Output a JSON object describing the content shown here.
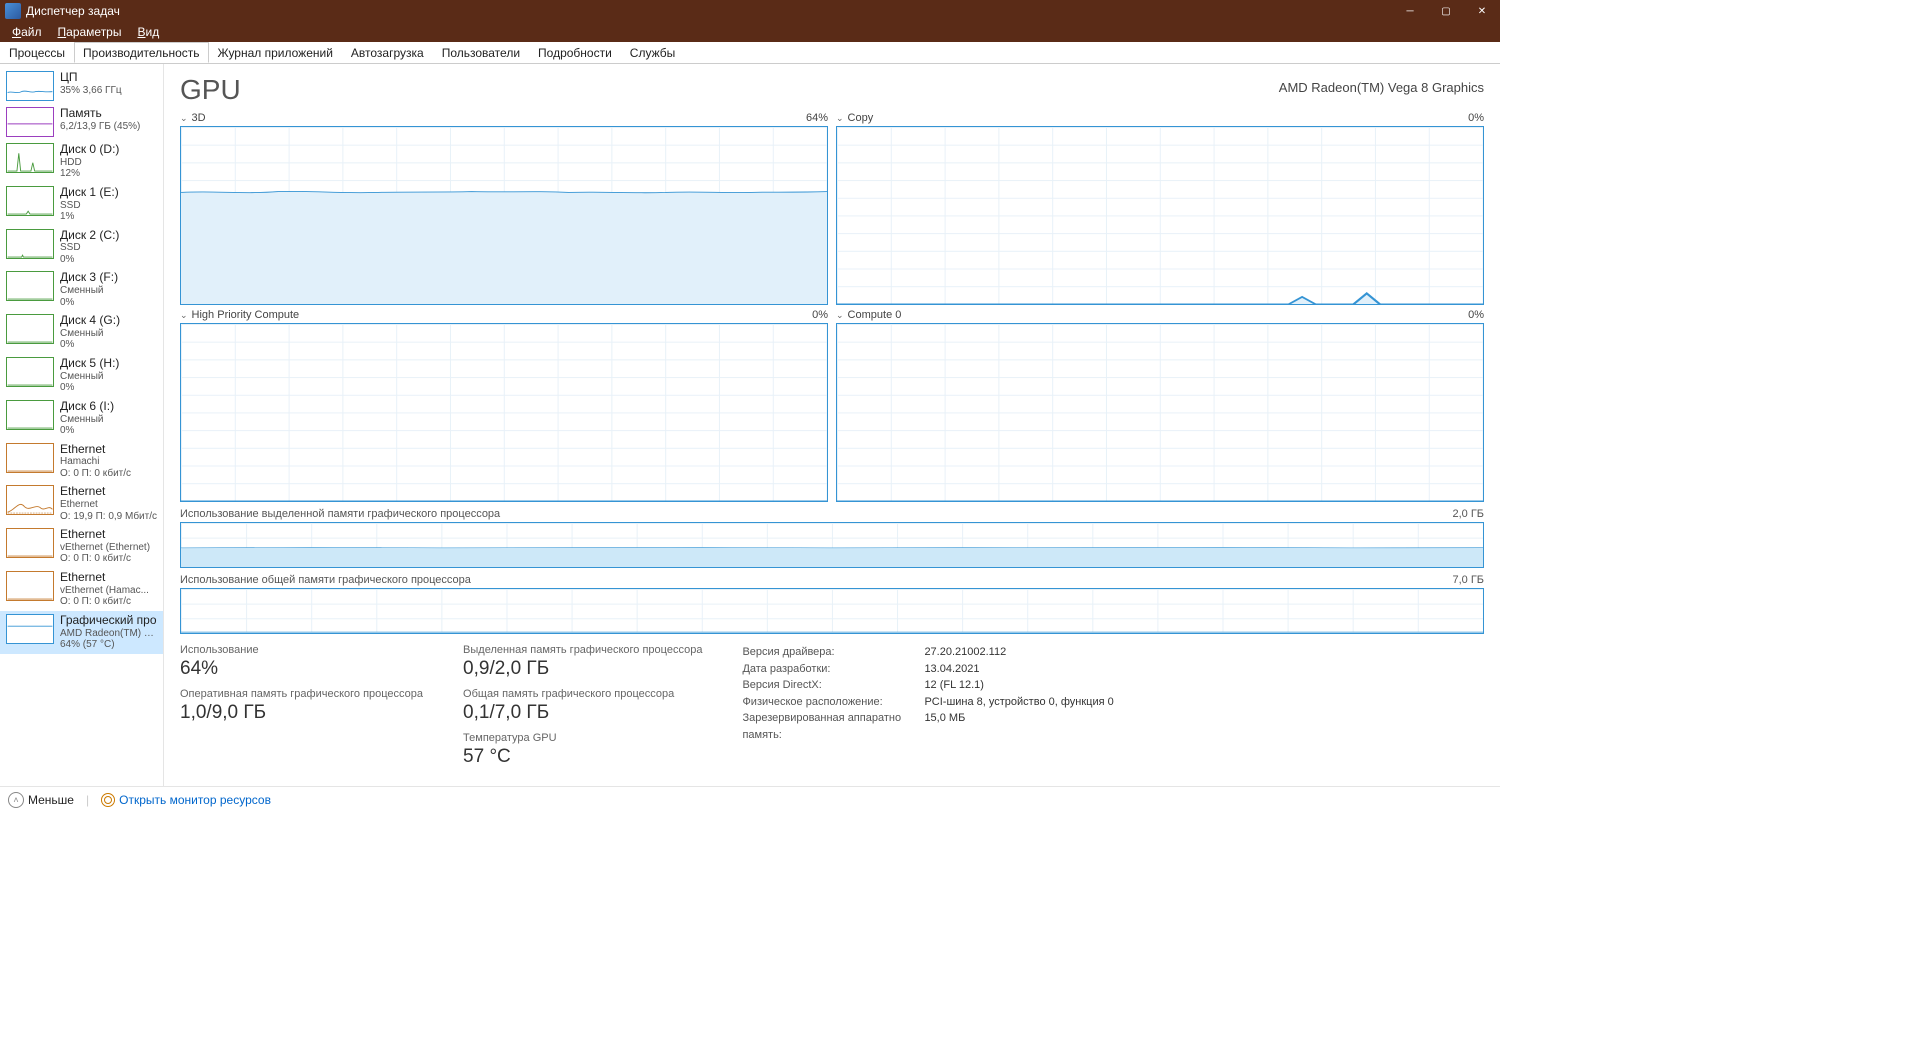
{
  "window": {
    "title": "Диспетчер задач"
  },
  "menu": {
    "file": "Файл",
    "options": "Параметры",
    "view": "Вид"
  },
  "tabs": [
    "Процессы",
    "Производительность",
    "Журнал приложений",
    "Автозагрузка",
    "Пользователи",
    "Подробности",
    "Службы"
  ],
  "activeTab": 1,
  "sidebar": [
    {
      "title": "ЦП",
      "sub1": "35% 3,66 ГГц",
      "color": "#3594d4",
      "chart": "wave35"
    },
    {
      "title": "Память",
      "sub1": "6,2/13,9 ГБ (45%)",
      "color": "#9b3fbf",
      "chart": "flat45"
    },
    {
      "title": "Диск 0 (D:)",
      "sub1": "HDD",
      "sub2": "12%",
      "color": "#4a9b3f",
      "chart": "spike"
    },
    {
      "title": "Диск 1 (E:)",
      "sub1": "SSD",
      "sub2": "1%",
      "color": "#4a9b3f",
      "chart": "low"
    },
    {
      "title": "Диск 2 (C:)",
      "sub1": "SSD",
      "sub2": "0%",
      "color": "#4a9b3f",
      "chart": "tiny"
    },
    {
      "title": "Диск 3 (F:)",
      "sub1": "Сменный",
      "sub2": "0%",
      "color": "#4a9b3f",
      "chart": "zero"
    },
    {
      "title": "Диск 4 (G:)",
      "sub1": "Сменный",
      "sub2": "0%",
      "color": "#4a9b3f",
      "chart": "zero"
    },
    {
      "title": "Диск 5 (H:)",
      "sub1": "Сменный",
      "sub2": "0%",
      "color": "#4a9b3f",
      "chart": "zero"
    },
    {
      "title": "Диск 6 (I:)",
      "sub1": "Сменный",
      "sub2": "0%",
      "color": "#4a9b3f",
      "chart": "zero"
    },
    {
      "title": "Ethernet",
      "sub1": "Hamachi",
      "sub2": "О: 0 П: 0 кбит/с",
      "color": "#c47a2e",
      "chart": "zero"
    },
    {
      "title": "Ethernet",
      "sub1": "Ethernet",
      "sub2": "О: 19,9 П: 0,9 Мбит/с",
      "color": "#c47a2e",
      "chart": "net"
    },
    {
      "title": "Ethernet",
      "sub1": "vEthernet (Ethernet)",
      "sub2": "О: 0 П: 0 кбит/с",
      "color": "#c47a2e",
      "chart": "zero"
    },
    {
      "title": "Ethernet",
      "sub1": "vEthernet (Hamac...",
      "sub2": "О: 0 П: 0 кбит/с",
      "color": "#c47a2e",
      "chart": "zero"
    },
    {
      "title": "Графический про",
      "sub1": "AMD Radeon(TM) Vega",
      "sub2": "64% (57 °C)",
      "color": "#3594d4",
      "chart": "gpu",
      "selected": true
    }
  ],
  "main": {
    "title": "GPU",
    "subtitle": "AMD Radeon(TM) Vega 8 Graphics",
    "engines": [
      {
        "name": "3D",
        "pct": "64%",
        "chart": "gpu64"
      },
      {
        "name": "Copy",
        "pct": "0%",
        "chart": "copyblip"
      },
      {
        "name": "High Priority Compute",
        "pct": "0%",
        "chart": "zero"
      },
      {
        "name": "Compute 0",
        "pct": "0%",
        "chart": "zero"
      }
    ],
    "dmem": {
      "label": "Использование выделенной памяти графического процессора",
      "max": "2,0 ГБ"
    },
    "smem": {
      "label": "Использование общей памяти графического процессора",
      "max": "7,0 ГБ"
    },
    "stats": {
      "util_label": "Использование",
      "util": "64%",
      "dmem_label": "Выделенная память графического процессора",
      "dmem": "0,9/2,0 ГБ",
      "gmem_label": "Оперативная память графического процессора",
      "gmem": "1,0/9,0 ГБ",
      "smem_label": "Общая память графического процессора",
      "smem": "0,1/7,0 ГБ",
      "temp_label": "Температура GPU",
      "temp": "57 °C"
    },
    "info": [
      {
        "k": "Версия драйвера:",
        "v": "27.20.21002.112"
      },
      {
        "k": "Дата разработки:",
        "v": "13.04.2021"
      },
      {
        "k": "Версия DirectX:",
        "v": "12 (FL 12.1)"
      },
      {
        "k": "Физическое расположение:",
        "v": "PCI-шина 8, устройство 0, функция 0"
      },
      {
        "k": "Зарезервированная аппаратно память:",
        "v": "15,0 МБ"
      }
    ]
  },
  "footer": {
    "less": "Меньше",
    "monitor": "Открыть монитор ресурсов"
  },
  "chart_data": {
    "type": "line",
    "series": [
      {
        "name": "3D",
        "values_pct_approx": 64,
        "range": [
          0,
          100
        ]
      },
      {
        "name": "Copy",
        "values_pct_approx": 0,
        "range": [
          0,
          100
        ]
      },
      {
        "name": "High Priority Compute",
        "values_pct_approx": 0,
        "range": [
          0,
          100
        ]
      },
      {
        "name": "Compute 0",
        "values_pct_approx": 0,
        "range": [
          0,
          100
        ]
      },
      {
        "name": "Dedicated GPU memory",
        "value": 0.9,
        "max": 2.0,
        "unit": "ГБ"
      },
      {
        "name": "Shared GPU memory",
        "value": 0.1,
        "max": 7.0,
        "unit": "ГБ"
      }
    ]
  }
}
